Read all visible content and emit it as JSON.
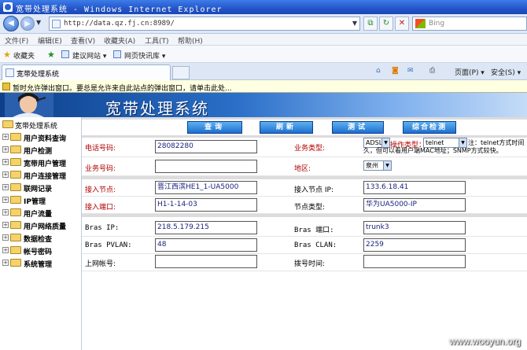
{
  "window": {
    "title": "宽带处理系统 - Windows Internet Explorer"
  },
  "address": {
    "url": "http://data.qz.fj.cn:8989/",
    "search_placeholder": "Bing"
  },
  "menu": [
    "文件(F)",
    "编辑(E)",
    "查看(V)",
    "收藏夹(A)",
    "工具(T)",
    "帮助(H)"
  ],
  "favorites": {
    "label": "收藏夹",
    "items": [
      "建议网站 ▾",
      "网页快讯库 ▾"
    ]
  },
  "tab": {
    "title": "宽带处理系统"
  },
  "commandbar": {
    "page": "页面(P) ▾",
    "safety": "安全(S) ▾"
  },
  "infobar": {
    "text": "暂时允许弹出窗口。要总是允许来自此站点的弹出窗口，请单击此处..."
  },
  "banner": {
    "title": "宽带处理系统"
  },
  "tree": {
    "root": "宽带处理系统",
    "items": [
      "用户资料查询",
      "用户检测",
      "宽带用户管理",
      "用户连接管理",
      "联网记录",
      "IP管理",
      "用户流量",
      "用户网络质量",
      "数据检查",
      "帐号密码",
      "系统管理"
    ]
  },
  "buttons": {
    "query": "查询",
    "refresh": "刷新",
    "test": "测试",
    "combined": "综合检测"
  },
  "form": {
    "phone_label": "电话号码:",
    "phone_value": "28082280",
    "biz_type_label": "业务类型:",
    "biz_type_value": "ADSL",
    "op_type_label": "操作类型：",
    "op_type_value": "telnet",
    "note": "注：telnet方式时间久，但可以看用户端MAC地址；SNMP方式较快。",
    "service_no_label": "业务号码:",
    "service_no_value": "",
    "area_label": "地区:",
    "area_value": "泉州",
    "access_node_label": "接入节点:",
    "access_node_value": "晋江西滨HE1_1-UA5000",
    "access_ip_label": "接入节点 IP:",
    "access_ip_value": "133.6.18.41",
    "access_port_label": "接入端口:",
    "access_port_value": "H1-1-14-03",
    "node_type_label": "节点类型:",
    "node_type_value": "华为UA5000-IP",
    "bras_ip_label": "Bras IP:",
    "bras_ip_value": "218.5.179.215",
    "bras_port_label": "Bras 端口:",
    "bras_port_value": "trunk3",
    "bras_pvlan_label": "Bras PVLAN:",
    "bras_pvlan_value": "48",
    "bras_clan_label": "Bras CLAN:",
    "bras_clan_value": "2259",
    "account_label": "上网帐号:",
    "account_value": "",
    "dial_time_label": "拨号时间:",
    "dial_time_value": ""
  },
  "watermark": "www.wooyun.org"
}
